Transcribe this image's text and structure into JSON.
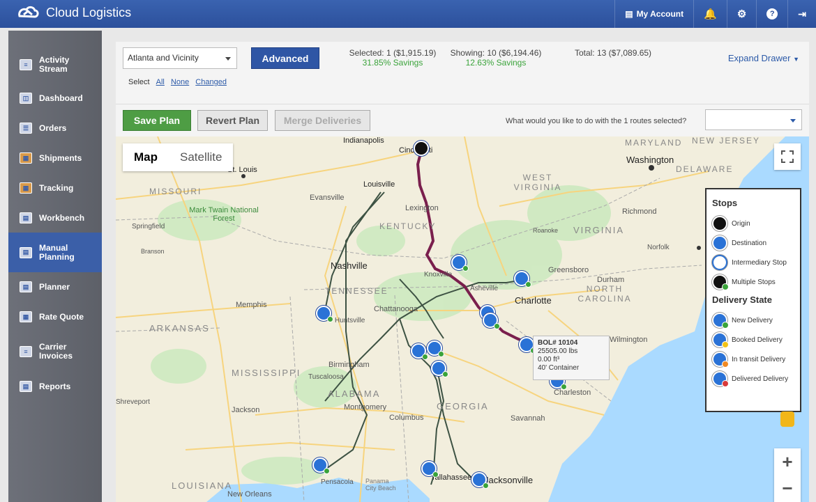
{
  "app": {
    "title": "Cloud Logistics"
  },
  "top_nav": {
    "account": "My Account"
  },
  "sidebar": {
    "items": [
      {
        "label": "Activity Stream"
      },
      {
        "label": "Dashboard"
      },
      {
        "label": "Orders"
      },
      {
        "label": "Shipments"
      },
      {
        "label": "Tracking"
      },
      {
        "label": "Workbench"
      },
      {
        "label": "Manual Planning",
        "active": true
      },
      {
        "label": "Planner"
      },
      {
        "label": "Rate Quote"
      },
      {
        "label": "Carrier Invoices"
      },
      {
        "label": "Reports"
      }
    ]
  },
  "filter": {
    "region": "Atlanta and Vicinity",
    "advanced_label": "Advanced",
    "selected": {
      "label": "Selected:",
      "value": "1 ($1,915.19)",
      "savings": "31.85% Savings"
    },
    "showing": {
      "label": "Showing:",
      "value": "10 ($6,194.46)",
      "savings": "12.63% Savings"
    },
    "total": {
      "label": "Total:",
      "value": "13 ($7,089.65)"
    },
    "expand_drawer": "Expand Drawer",
    "select_label": "Select",
    "select_all": "All",
    "select_none": "None",
    "select_changed": "Changed"
  },
  "actions": {
    "save": "Save Plan",
    "revert": "Revert Plan",
    "merge": "Merge Deliveries",
    "routes_question": "What would you like to do with the 1 routes selected?"
  },
  "map": {
    "tab_map": "Map",
    "tab_satellite": "Satellite",
    "tooltip": {
      "bol": "BOL# 10104",
      "weight": "25505.00 lbs",
      "volume": "0.00 ft³",
      "container": "40' Container"
    },
    "labels": {
      "indianapolis": "Indianapolis",
      "cincinnati": "Cincinnati",
      "st_louis": "St. Louis",
      "louisville": "Louisville",
      "missouri": "MISSOURI",
      "evansville": "Evansville",
      "lexington": "Lexington",
      "kentucky": "KENTUCKY",
      "west_virginia": "WEST VIRGINIA",
      "maryland": "MARYLAND",
      "new_jersey": "NEW JERSEY",
      "washington": "Washington",
      "delaware": "DELAWARE",
      "mark_twain": "Mark Twain National Forest",
      "springfield": "Springfield",
      "branson": "Branson",
      "richmond": "Richmond",
      "virginia": "VIRGINIA",
      "roanoke": "Roanoke",
      "norfolk": "Norfolk",
      "nashville": "Nashville",
      "knoxville": "Knoxville",
      "greensboro": "Greensboro",
      "durham": "Durham",
      "asheville": "Asheville",
      "charlotte": "Charlotte",
      "north_carolina": "NORTH CAROLINA",
      "tennessee": "TENNESSEE",
      "memphis": "Memphis",
      "chattanooga": "Chattanooga",
      "huntsville": "Huntsville",
      "arkansas": "ARKANSAS",
      "wilmington": "Wilmington",
      "birmingham": "Birmingham",
      "tuscaloosa": "Tuscaloosa",
      "mississippi": "MISSISSIPPI",
      "alabama": "ALABAMA",
      "charleston": "Charleston",
      "shreveport": "Shreveport",
      "jackson": "Jackson",
      "montgomery": "Montgomery",
      "georgia": "GEORGIA",
      "columbus": "Columbus",
      "savannah": "Savannah",
      "louisiana": "LOUISIANA",
      "pensacola": "Pensacola",
      "panama_city": "Panama City Beach",
      "tallahassee": "Tallahassee",
      "jacksonville": "Jacksonville",
      "new_orleans": "New Orleans"
    }
  },
  "legend": {
    "stops_title": "Stops",
    "origin": "Origin",
    "destination": "Destination",
    "intermediary": "Intermediary Stop",
    "multiple": "Multiple Stops",
    "delivery_title": "Delivery State",
    "new_delivery": "New Delivery",
    "booked_delivery": "Booked Delivery",
    "in_transit": "In transit Delivery",
    "delivered": "Delivered Delivery"
  }
}
